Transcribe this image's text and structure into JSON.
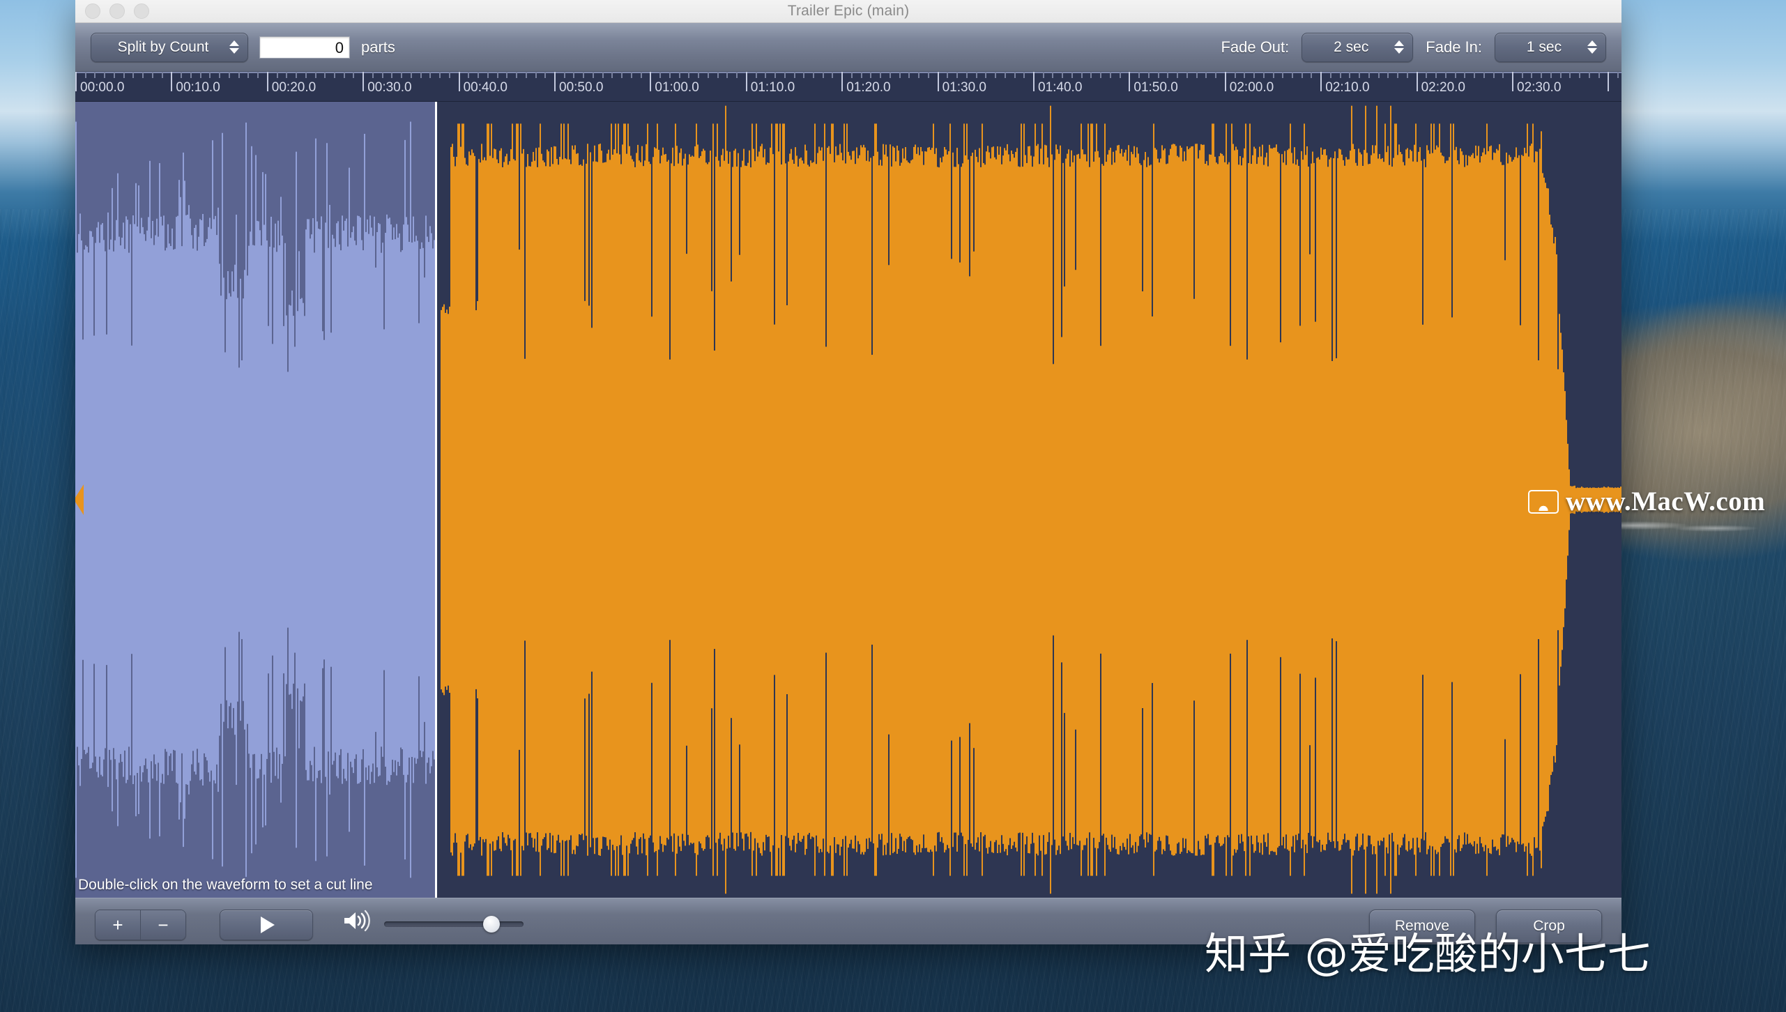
{
  "window": {
    "title": "Trailer Epic (main)",
    "traffic_lights": [
      "close",
      "minimize",
      "zoom"
    ]
  },
  "toolbar": {
    "split_mode_label": "Split by Count",
    "parts_value": "0",
    "parts_label": "parts",
    "fade_out_label": "Fade Out:",
    "fade_out_value": "2 sec",
    "fade_in_label": "Fade In:",
    "fade_in_value": "1 sec"
  },
  "ruler": {
    "labels": [
      "00:00.0",
      "00:10.0",
      "00:20.0",
      "00:30.0",
      "00:40.0",
      "00:50.0",
      "01:00.0",
      "01:10.0",
      "01:20.0",
      "01:30.0",
      "01:40.0",
      "01:50.0",
      "02:00.0",
      "02:10.0",
      "02:20.0",
      "02:30.0"
    ],
    "major_interval_sec": 10,
    "minor_ticks_per_major": 10,
    "start_time": "00:00.0",
    "end_time": "02:35.0"
  },
  "waveform": {
    "hint": "Double-click on the waveform to set a cut line",
    "selection_start": "00:00.0",
    "selection_end": "00:37.5",
    "colors": {
      "background": "#2e3652",
      "selection_background": "#5b6490",
      "selection_wave": "#92a0d8",
      "wave": "#e8941d",
      "cut_line": "#ffffff",
      "handle": "#e8941d"
    }
  },
  "transport": {
    "zoom_in_label": "+",
    "zoom_out_label": "−",
    "play_label": "play",
    "volume_icon": "speaker-icon",
    "volume_percent": 71
  },
  "actions": {
    "remove_label": "Remove",
    "crop_label": "Crop"
  },
  "watermarks": {
    "site": "www.MacW.com",
    "zhihu": "知乎 @爱吃酸的小七七"
  }
}
